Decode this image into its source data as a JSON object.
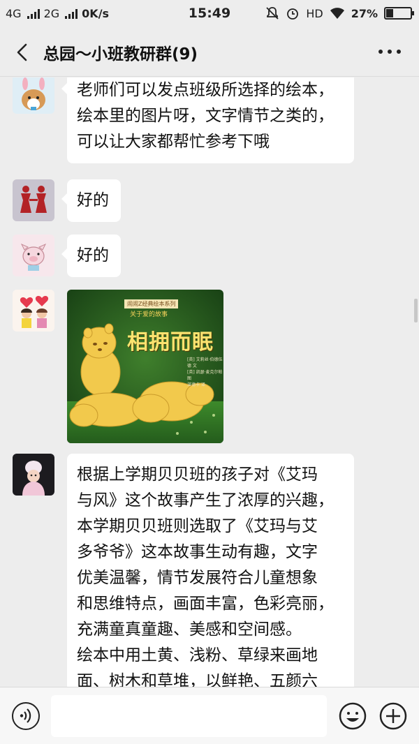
{
  "status_bar": {
    "network_1": "4G",
    "network_2": "2G",
    "speed": "0K/s",
    "time": "15:49",
    "hd": "HD",
    "battery": "27%",
    "battery_level": 0.27
  },
  "header": {
    "title": "总园～小班教研群(9)",
    "back_icon": "chevron-left-icon",
    "more_icon": "more-dots-icon"
  },
  "messages": [
    {
      "type": "text",
      "avatar": "corgi-avatar",
      "text": "老师们可以发点班级所选择的绘本，\n绘本里的图片呀，文字情节之类的，\n可以让大家都帮忙参考下哦"
    },
    {
      "type": "text",
      "avatar": "papercut-avatar",
      "text": "好的"
    },
    {
      "type": "text",
      "avatar": "pig-avatar",
      "text": "好的"
    },
    {
      "type": "image",
      "avatar": "kids-avatar",
      "book": {
        "badge": "闹闹Z经典绘本系列",
        "series": "关于爱的故事",
        "title": "相拥而眠",
        "credits": "[英] 艾莉丝·伯德伍德 文\n[英] 凯瑟·麦克尔帕 图\n湛德卡 译"
      }
    },
    {
      "type": "text",
      "avatar": "girl-avatar",
      "text": "根据上学期贝贝班的孩子对《艾玛\n与风》这个故事产生了浓厚的兴趣，\n本学期贝贝班则选取了《艾玛与艾\n多爷爷》这本故事生动有趣，文字\n优美温馨，情节发展符合儿童想象\n和思维特点，画面丰富，色彩亮丽，\n充满童真童趣、美感和空间感。\n绘本中用土黄、浅粉、草绿来画地\n面、树木和草堆，以鲜艳、五颜六"
    }
  ],
  "input_bar": {
    "voice_icon": "voice-icon",
    "emoji_icon": "emoji-icon",
    "plus_icon": "plus-icon",
    "placeholder": ""
  }
}
